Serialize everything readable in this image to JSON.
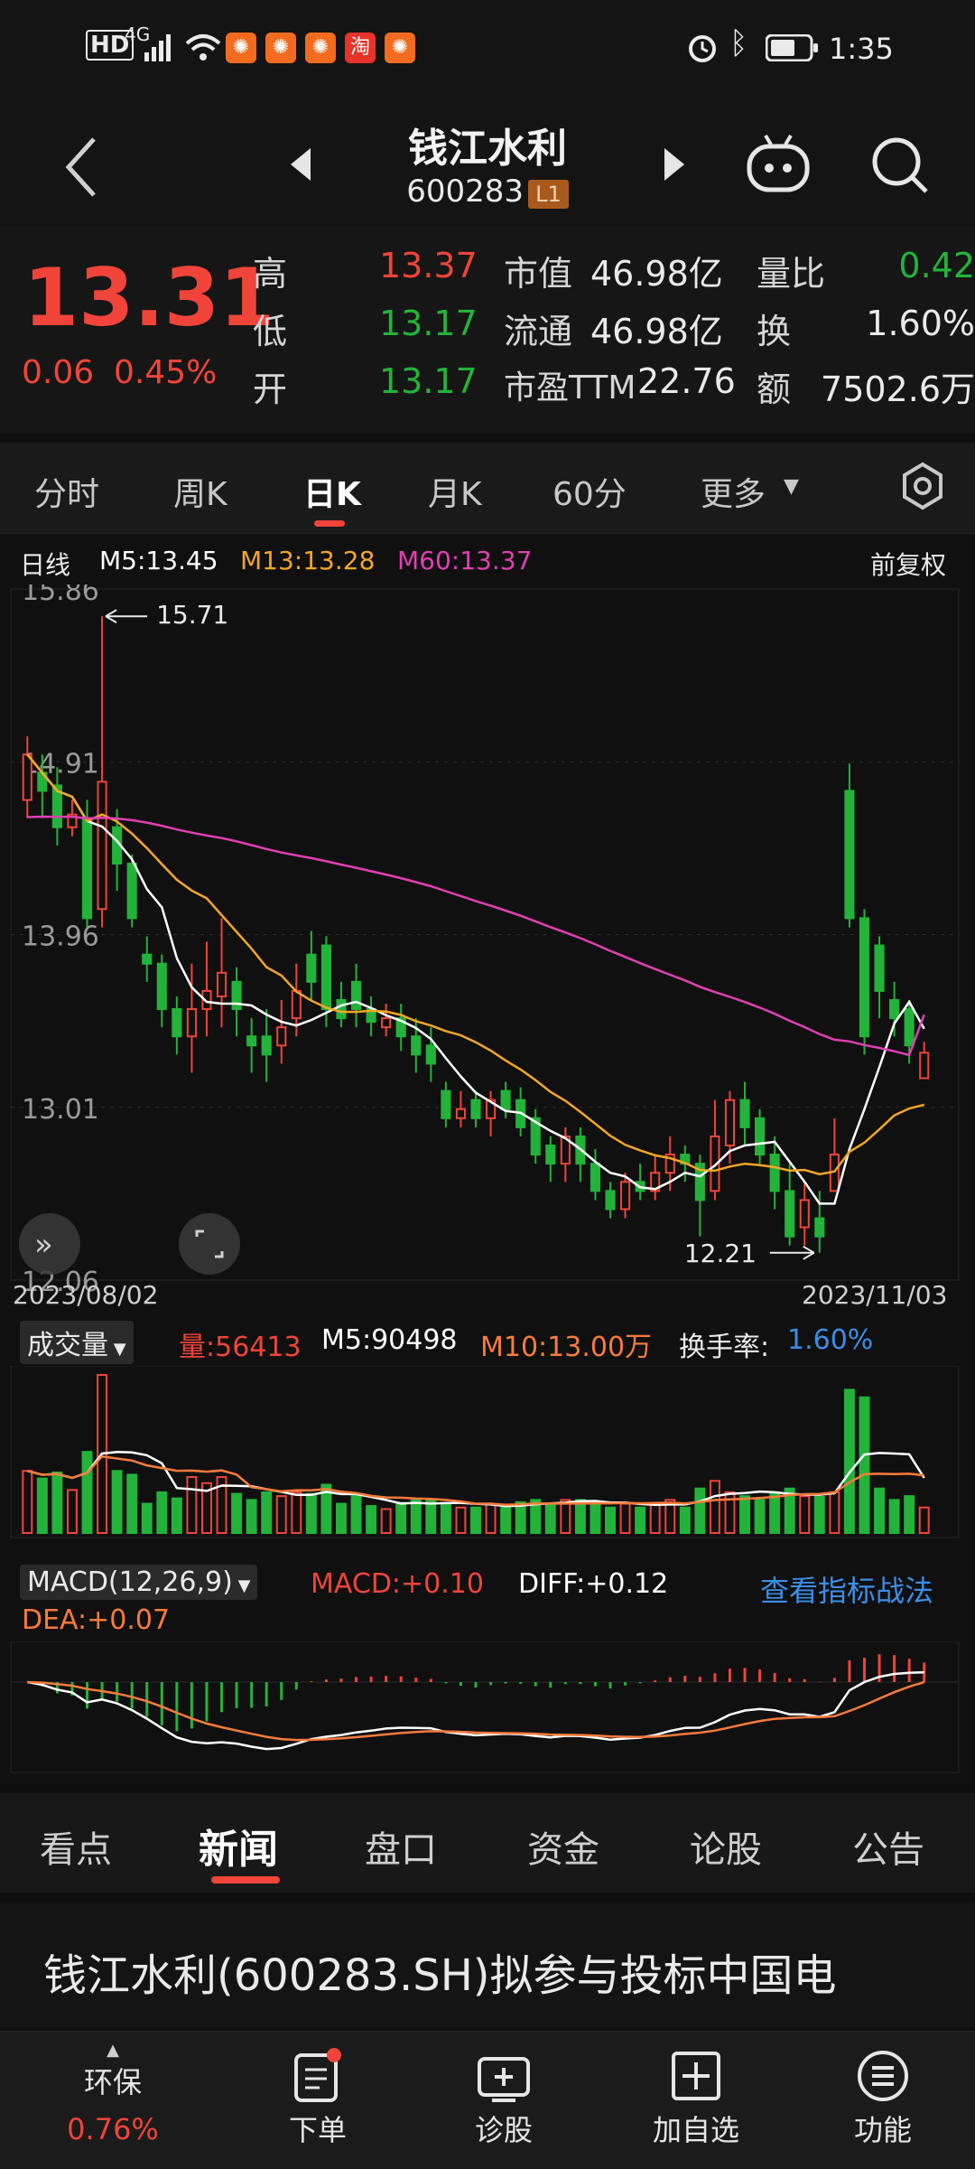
{
  "status_bar": {
    "left_icons": [
      "HD",
      "4G",
      "signal-icon",
      "wifi-icon"
    ],
    "time": "1:35"
  },
  "header": {
    "title": "钱江水利",
    "code": "600283",
    "level_badge": "L1"
  },
  "quote": {
    "price": "13.31",
    "change": "0.06",
    "change_pct": "0.45%",
    "rows": [
      {
        "l1": "高",
        "v1": "13.37",
        "v1_color": "red",
        "l2": "市值",
        "v2": "46.98亿",
        "l3": "量比",
        "v3": "0.42",
        "v3_color": "green"
      },
      {
        "l1": "低",
        "v1": "13.17",
        "v1_color": "green",
        "l2": "流通",
        "v2": "46.98亿",
        "l3": "换",
        "v3": "1.60%",
        "v3_color": "white"
      },
      {
        "l1": "开",
        "v1": "13.17",
        "v1_color": "green",
        "l2": "市盈TTM",
        "v2": "22.76",
        "l3": "额",
        "v3": "7502.6万",
        "v3_color": "white"
      }
    ]
  },
  "period_tabs": [
    "分时",
    "周K",
    "日K",
    "月K",
    "60分",
    "更多"
  ],
  "period_tab_active": "日K",
  "kline": {
    "label": "日线",
    "m5": "M5:13.45",
    "m13": "M13:13.28",
    "m60": "M60:13.37",
    "adjust": "前复权",
    "y_labels": [
      "15.86",
      "14.91",
      "13.96",
      "13.01",
      "12.06"
    ],
    "high_marker": "15.71",
    "low_marker": "12.21",
    "start_date": "2023/08/02",
    "end_date": "2023/11/03"
  },
  "volume": {
    "selector": "成交量",
    "vol": "量:56413",
    "m5": "M5:90498",
    "m10": "M10:13.00万",
    "turnover_label": "换手率:",
    "turnover_value": "1.60%"
  },
  "macd": {
    "selector": "MACD(12,26,9)",
    "macd": "MACD:+0.10",
    "diff": "DIFF:+0.12",
    "dea": "DEA:+0.07",
    "link": "查看指标战法"
  },
  "news_tabs": [
    "看点",
    "新闻",
    "盘口",
    "资金",
    "论股",
    "公告"
  ],
  "news_tab_active": "新闻",
  "headline": "钱江水利(600283.SH)拟参与投标中国电",
  "bottom_nav": {
    "env": {
      "label": "环保",
      "value": "0.76%"
    },
    "items": [
      "下单",
      "诊股",
      "加自选",
      "功能"
    ]
  },
  "colors": {
    "up": "#f0443a",
    "down": "#23b33a",
    "m5": "#ffffff",
    "m13": "#f5a623",
    "m60": "#e23fb4",
    "link": "#3b8ee8"
  },
  "chart_data": {
    "type": "candlestick",
    "ma_series": [
      "M5",
      "M13",
      "M60"
    ],
    "ylim": [
      12.06,
      15.86
    ],
    "candles": [
      {
        "o": 14.7,
        "c": 14.95,
        "h": 15.05,
        "l": 14.6
      },
      {
        "o": 14.85,
        "c": 14.75,
        "h": 14.95,
        "l": 14.6
      },
      {
        "o": 14.78,
        "c": 14.55,
        "h": 14.88,
        "l": 14.45
      },
      {
        "o": 14.55,
        "c": 14.62,
        "h": 14.7,
        "l": 14.5
      },
      {
        "o": 14.6,
        "c": 14.05,
        "h": 14.7,
        "l": 14.0
      },
      {
        "o": 14.1,
        "c": 14.8,
        "h": 15.71,
        "l": 14.0
      },
      {
        "o": 14.55,
        "c": 14.35,
        "h": 14.65,
        "l": 14.2
      },
      {
        "o": 14.35,
        "c": 14.05,
        "h": 14.4,
        "l": 14.0
      },
      {
        "o": 13.85,
        "c": 13.8,
        "h": 13.95,
        "l": 13.7
      },
      {
        "o": 13.8,
        "c": 13.55,
        "h": 13.85,
        "l": 13.45
      },
      {
        "o": 13.55,
        "c": 13.4,
        "h": 13.62,
        "l": 13.3
      },
      {
        "o": 13.4,
        "c": 13.55,
        "h": 13.8,
        "l": 13.2
      },
      {
        "o": 13.55,
        "c": 13.65,
        "h": 13.92,
        "l": 13.4
      },
      {
        "o": 13.62,
        "c": 13.75,
        "h": 14.05,
        "l": 13.45
      },
      {
        "o": 13.7,
        "c": 13.55,
        "h": 13.78,
        "l": 13.4
      },
      {
        "o": 13.4,
        "c": 13.35,
        "h": 13.5,
        "l": 13.2
      },
      {
        "o": 13.4,
        "c": 13.3,
        "h": 13.55,
        "l": 13.15
      },
      {
        "o": 13.35,
        "c": 13.45,
        "h": 13.6,
        "l": 13.25
      },
      {
        "o": 13.5,
        "c": 13.65,
        "h": 13.8,
        "l": 13.4
      },
      {
        "o": 13.85,
        "c": 13.7,
        "h": 13.98,
        "l": 13.6
      },
      {
        "o": 13.9,
        "c": 13.55,
        "h": 13.95,
        "l": 13.45
      },
      {
        "o": 13.6,
        "c": 13.5,
        "h": 13.7,
        "l": 13.45
      },
      {
        "o": 13.7,
        "c": 13.55,
        "h": 13.8,
        "l": 13.45
      },
      {
        "o": 13.55,
        "c": 13.48,
        "h": 13.62,
        "l": 13.4
      },
      {
        "o": 13.45,
        "c": 13.5,
        "h": 13.58,
        "l": 13.4
      },
      {
        "o": 13.5,
        "c": 13.4,
        "h": 13.58,
        "l": 13.32
      },
      {
        "o": 13.4,
        "c": 13.3,
        "h": 13.5,
        "l": 13.2
      },
      {
        "o": 13.35,
        "c": 13.25,
        "h": 13.45,
        "l": 13.15
      },
      {
        "o": 13.1,
        "c": 12.95,
        "h": 13.15,
        "l": 12.9
      },
      {
        "o": 12.95,
        "c": 13.0,
        "h": 13.1,
        "l": 12.9
      },
      {
        "o": 13.05,
        "c": 12.95,
        "h": 13.1,
        "l": 12.9
      },
      {
        "o": 12.95,
        "c": 13.05,
        "h": 13.1,
        "l": 12.85
      },
      {
        "o": 13.1,
        "c": 13.0,
        "h": 13.15,
        "l": 12.95
      },
      {
        "o": 13.05,
        "c": 12.9,
        "h": 13.12,
        "l": 12.85
      },
      {
        "o": 12.95,
        "c": 12.75,
        "h": 13.0,
        "l": 12.7
      },
      {
        "o": 12.8,
        "c": 12.7,
        "h": 12.85,
        "l": 12.6
      },
      {
        "o": 12.7,
        "c": 12.85,
        "h": 12.9,
        "l": 12.6
      },
      {
        "o": 12.85,
        "c": 12.7,
        "h": 12.9,
        "l": 12.6
      },
      {
        "o": 12.7,
        "c": 12.55,
        "h": 12.78,
        "l": 12.5
      },
      {
        "o": 12.55,
        "c": 12.45,
        "h": 12.6,
        "l": 12.4
      },
      {
        "o": 12.45,
        "c": 12.6,
        "h": 12.65,
        "l": 12.4
      },
      {
        "o": 12.6,
        "c": 12.55,
        "h": 12.7,
        "l": 12.5
      },
      {
        "o": 12.55,
        "c": 12.65,
        "h": 12.75,
        "l": 12.5
      },
      {
        "o": 12.65,
        "c": 12.75,
        "h": 12.85,
        "l": 12.55
      },
      {
        "o": 12.75,
        "c": 12.7,
        "h": 12.8,
        "l": 12.6
      },
      {
        "o": 12.7,
        "c": 12.5,
        "h": 12.75,
        "l": 12.3
      },
      {
        "o": 12.55,
        "c": 12.85,
        "h": 13.05,
        "l": 12.5
      },
      {
        "o": 12.8,
        "c": 13.05,
        "h": 13.1,
        "l": 12.7
      },
      {
        "o": 13.05,
        "c": 12.9,
        "h": 13.15,
        "l": 12.8
      },
      {
        "o": 12.95,
        "c": 12.75,
        "h": 13.0,
        "l": 12.7
      },
      {
        "o": 12.75,
        "c": 12.55,
        "h": 12.85,
        "l": 12.45
      },
      {
        "o": 12.55,
        "c": 12.3,
        "h": 12.7,
        "l": 12.25
      },
      {
        "o": 12.35,
        "c": 12.5,
        "h": 12.6,
        "l": 12.25
      },
      {
        "o": 12.4,
        "c": 12.3,
        "h": 12.55,
        "l": 12.21
      },
      {
        "o": 12.55,
        "c": 12.75,
        "h": 12.95,
        "l": 12.55
      },
      {
        "o": 14.75,
        "c": 14.05,
        "h": 14.9,
        "l": 14.0
      },
      {
        "o": 14.05,
        "c": 13.4,
        "h": 14.1,
        "l": 13.3
      },
      {
        "o": 13.9,
        "c": 13.65,
        "h": 13.95,
        "l": 13.5
      },
      {
        "o": 13.6,
        "c": 13.5,
        "h": 13.7,
        "l": 13.4
      },
      {
        "o": 13.55,
        "c": 13.35,
        "h": 13.6,
        "l": 13.25
      },
      {
        "o": 13.17,
        "c": 13.31,
        "h": 13.37,
        "l": 13.17
      }
    ],
    "volume_ma_labels": [
      "M5",
      "M10"
    ],
    "macd_series": [
      "DIFF",
      "DEA"
    ]
  }
}
